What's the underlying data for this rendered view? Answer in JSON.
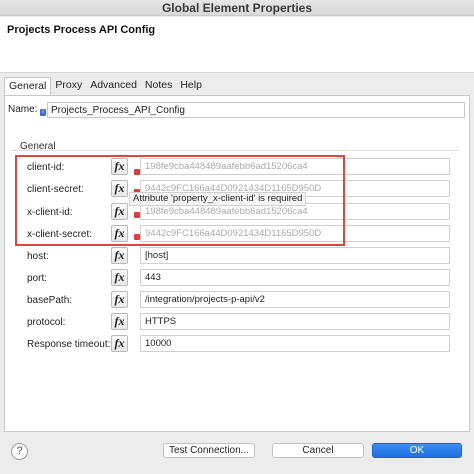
{
  "window": {
    "title": "Global Element Properties"
  },
  "header": {
    "heading": "Projects Process API Config"
  },
  "tabs": [
    {
      "label": "General",
      "active": true
    },
    {
      "label": "Proxy",
      "active": false
    },
    {
      "label": "Advanced",
      "active": false
    },
    {
      "label": "Notes",
      "active": false
    },
    {
      "label": "Help",
      "active": false
    }
  ],
  "name": {
    "label": "Name:",
    "value": "Projects_Process_API_Config",
    "info_icon": "info-icon"
  },
  "group": {
    "label": "General"
  },
  "fx_label": "fx",
  "fields": [
    {
      "label": "client-id:",
      "value": "198fe9cba448489aafebb6ad15206ca4",
      "placeholder": true,
      "error": true
    },
    {
      "label": "client-secret:",
      "value": "9442c9FC166a44D0921434D1165D950D",
      "placeholder": true,
      "error": true
    },
    {
      "label": "x-client-id:",
      "value": "198fe9cba448489aafebb6ad15206ca4",
      "placeholder": true,
      "error": true
    },
    {
      "label": "x-client-secret:",
      "value": "9442c9FC166a44D0921434D1165D950D",
      "placeholder": true,
      "error": true
    },
    {
      "label": "host:",
      "value": "[host]",
      "placeholder": false,
      "error": false
    },
    {
      "label": "port:",
      "value": "443",
      "placeholder": false,
      "error": false
    },
    {
      "label": "basePath:",
      "value": "/integration/projects-p-api/v2",
      "placeholder": false,
      "error": false
    },
    {
      "label": "protocol:",
      "value": "HTTPS",
      "placeholder": false,
      "error": false
    },
    {
      "label": "Response timeout:",
      "value": "10000",
      "placeholder": false,
      "error": false
    }
  ],
  "tooltip": {
    "text": "Attribute 'property_x-client-id' is required"
  },
  "footer": {
    "help_label": "?",
    "test_connection": "Test Connection...",
    "cancel": "Cancel",
    "ok": "OK"
  },
  "colors": {
    "highlight": "#e0443a",
    "primary": "#1f6fe0",
    "error": "#e03b3b"
  }
}
